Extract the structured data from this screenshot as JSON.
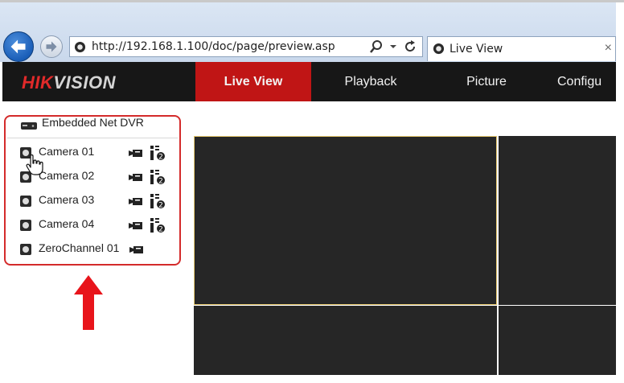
{
  "browser": {
    "address": "http://192.168.1.100/doc/page/preview.asp",
    "tab_title": "Live View",
    "tab_close": "×",
    "icons": [
      "back-arrow-icon",
      "forward-arrow-icon",
      "search-icon",
      "refresh-icon",
      "page-icon"
    ]
  },
  "app": {
    "logo_part1": "HIK",
    "logo_part2": "VISION",
    "nav": [
      {
        "label": "Live View",
        "active": true
      },
      {
        "label": "Playback",
        "active": false
      },
      {
        "label": "Picture",
        "active": false
      },
      {
        "label": "Configu",
        "active": false
      }
    ]
  },
  "tree": {
    "device": "Embedded Net DVR",
    "channels": [
      {
        "label": "Camera 01",
        "icons": [
          "record-icon",
          "ptz-icon"
        ]
      },
      {
        "label": "Camera 02",
        "icons": [
          "record-icon",
          "ptz-icon"
        ]
      },
      {
        "label": "Camera 03",
        "icons": [
          "record-icon",
          "ptz-icon"
        ]
      },
      {
        "label": "Camera 04",
        "icons": [
          "record-icon",
          "ptz-icon"
        ]
      },
      {
        "label": "ZeroChannel 01",
        "icons": [
          "record-icon"
        ]
      }
    ]
  },
  "colors": {
    "accent": "#c01515",
    "highlight_border": "#d42b2b",
    "video_bg": "#262626",
    "selected_window": "#e5c66c"
  }
}
